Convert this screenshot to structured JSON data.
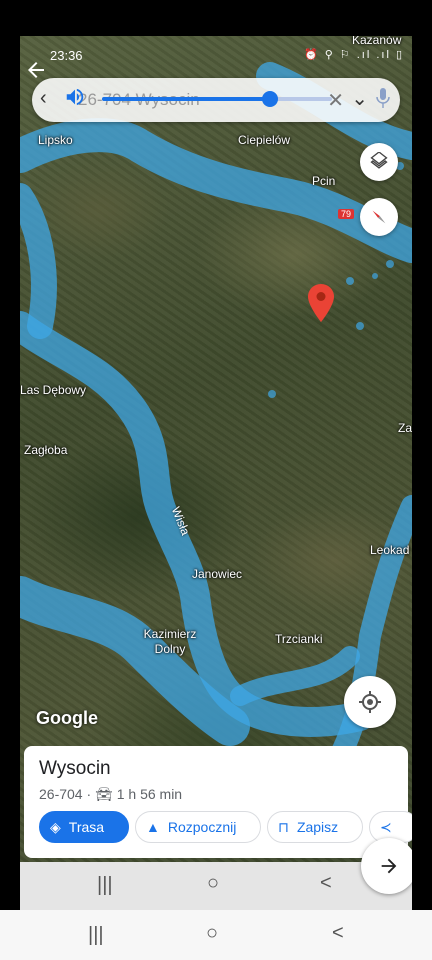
{
  "status": {
    "time": "23:36",
    "right_icons": "⏰ ⚲ ⚐ .ıl .ıl ▯"
  },
  "search": {
    "query": "26-704 Wysocin",
    "volume_level": 0.73
  },
  "map": {
    "places": [
      {
        "name": "Lipsko",
        "key": "lipsko"
      },
      {
        "name": "Ciepielów",
        "key": "ciepielow"
      },
      {
        "name": "Pcin",
        "key": "pcin"
      },
      {
        "name": "Kazanów",
        "key": "kazanow"
      },
      {
        "name": "Las Dębowy",
        "key": "las-debowy"
      },
      {
        "name": "Zagłoba",
        "key": "zagloba"
      },
      {
        "name": "Janowiec",
        "key": "janowiec"
      },
      {
        "name": "Kazimierz Dolny",
        "key": "kazimierz-dolny"
      },
      {
        "name": "Trzcianki",
        "key": "trzcianki"
      },
      {
        "name": "Leokad",
        "key": "leokad"
      },
      {
        "name": "Za",
        "key": "za"
      }
    ],
    "river": "Wisła",
    "road_number": "79",
    "logo": "Google"
  },
  "card": {
    "title": "Wysocin",
    "postal": "26-704",
    "separator": "·",
    "duration": "1 h 56 min",
    "buttons": {
      "route": "Trasa",
      "start": "Rozpocznij",
      "save": "Zapisz"
    }
  },
  "icons": {
    "layers": "layers-icon",
    "compass": "compass-icon",
    "location": "my-location-icon",
    "next": "arrow-right-icon",
    "back": "arrow-left-icon",
    "volume": "volume-icon"
  },
  "colors": {
    "accent": "#1a73e8",
    "pin": "#ea4335",
    "flood_zone": "#3fa7e6"
  },
  "nav": {
    "recents": "|||",
    "home": "○",
    "back": "<"
  }
}
